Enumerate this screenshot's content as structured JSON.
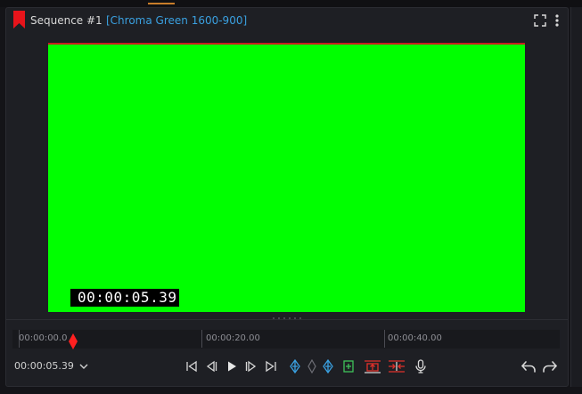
{
  "header": {
    "sequence_title": "Sequence #1",
    "clip_name": "[Chroma Green 1600-900]",
    "flag_color": "#e8141b"
  },
  "viewer": {
    "frame_color": "#00ff00",
    "timecode_overlay": "00:00:05.39"
  },
  "timeline": {
    "ruler_labels": [
      "00:00:00.0",
      "00:00:20.00",
      "00:00:40.00"
    ],
    "playhead_color": "#ff2020"
  },
  "transport": {
    "current_time": "00:00:05.39",
    "controls": [
      "skip-to-start-icon",
      "step-back-icon",
      "play-icon",
      "step-forward-icon",
      "skip-to-end-icon",
      "mark-in-icon",
      "add-keyframe-icon",
      "mark-out-icon",
      "insert-clip-icon",
      "lift-icon",
      "extract-icon",
      "microphone-icon",
      "undo-icon",
      "redo-icon"
    ]
  },
  "colors": {
    "accent_blue": "#3aa0e0",
    "accent_green": "#3fc35a",
    "accent_red": "#e0302a"
  }
}
